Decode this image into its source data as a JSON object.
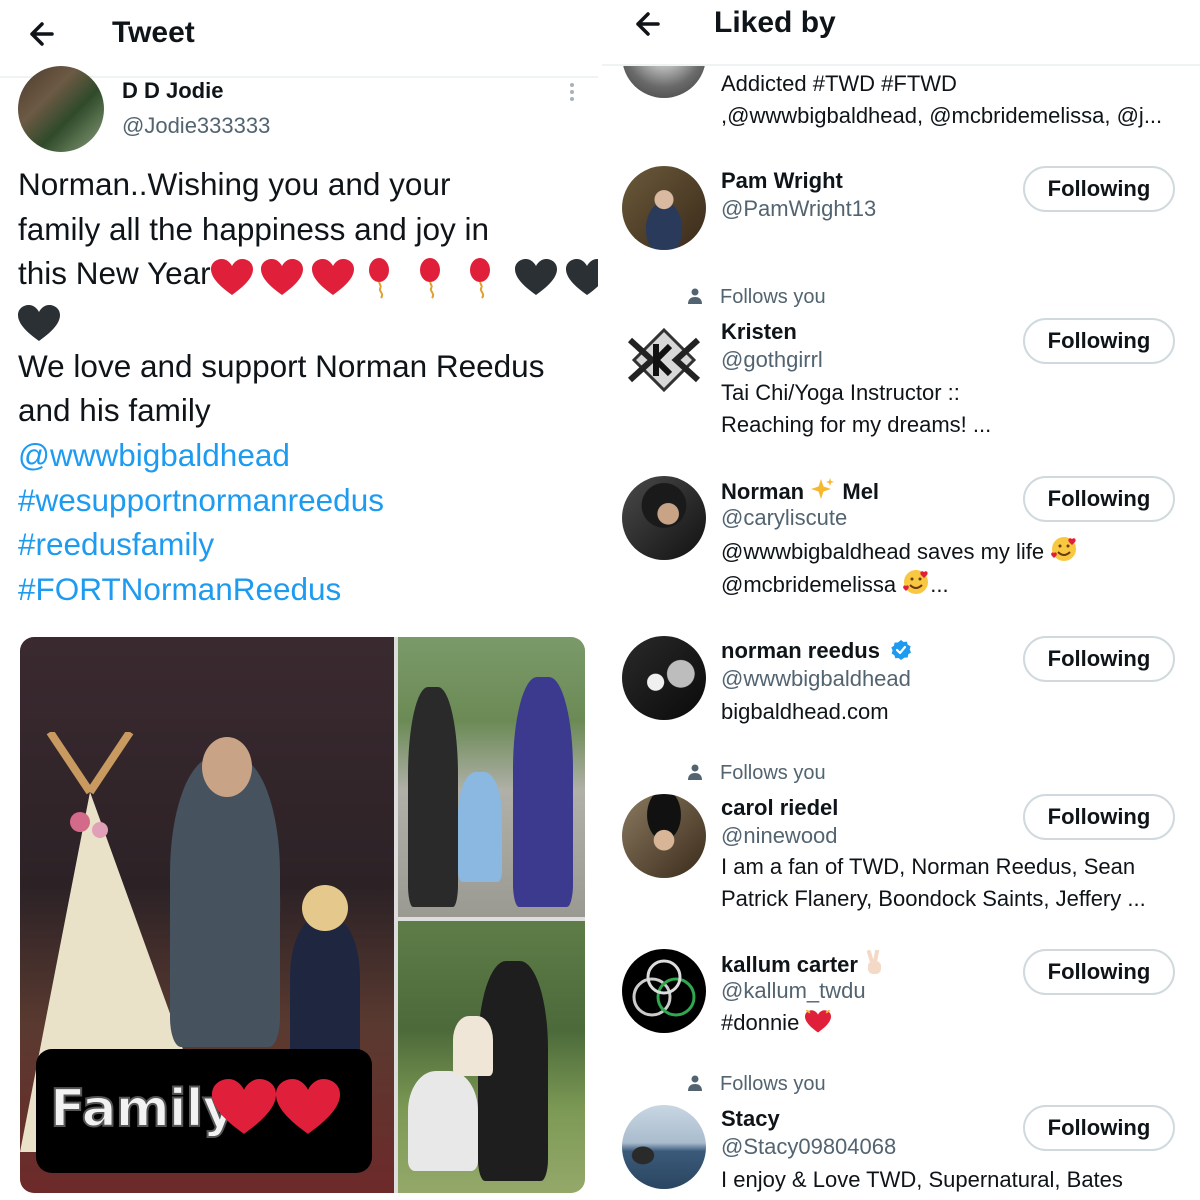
{
  "tweet_screen": {
    "title": "Tweet",
    "author": {
      "name": "D D Jodie",
      "handle": "@Jodie333333"
    },
    "text_lines": [
      "Norman..Wishing you and your",
      "family all the happiness and joy in",
      "this New Year",
      "We love and support Norman Reedus",
      "and his family"
    ],
    "links": [
      "@wwwbigbaldhead",
      "#wesupportnormanreedus",
      "#reedusfamily",
      "#FORTNormanReedus"
    ],
    "emojis": [
      "red-heart",
      "red-heart",
      "red-heart",
      "balloon",
      "balloon",
      "balloon",
      "black-heart",
      "black-heart",
      "black-heart"
    ],
    "media_caption": "Family",
    "colors": {
      "link": "#1d9bf0",
      "secondary": "#536471"
    }
  },
  "liked_by_screen": {
    "title": "Liked by",
    "follows_you_label": "Follows you",
    "top_partial_bio": [
      "Addicted #TWD #FTWD",
      ",@wwwbigbaldhead, @mcbridemelissa, @j..."
    ],
    "users": [
      {
        "name": "Pam Wright",
        "handle": "@PamWright13",
        "button": "Following",
        "bio": []
      },
      {
        "name": "Kristen",
        "handle": "@gothgirrl",
        "button": "Following",
        "follows_you": true,
        "bio": [
          "Tai Chi/Yoga Instructor ::",
          "Reaching for my dreams! ..."
        ]
      },
      {
        "name_a": "Norman",
        "name_b": "Mel",
        "handle": "@caryliscute",
        "button": "Following",
        "bio": [
          "@wwwbigbaldhead saves my life",
          "@mcbridemelissa",
          "..."
        ]
      },
      {
        "name": "norman reedus",
        "handle": "@wwwbigbaldhead",
        "button": "Following",
        "verified": true,
        "bio": [
          "bigbaldhead.com"
        ]
      },
      {
        "name": "carol riedel",
        "handle": "@ninewood",
        "button": "Following",
        "follows_you": true,
        "bio": [
          "I am a fan of TWD, Norman Reedus, Sean",
          "Patrick Flanery, Boondock Saints, Jeffery ..."
        ]
      },
      {
        "name": "kallum carter",
        "handle": "@kallum_twdu",
        "button": "Following",
        "bio": [
          "#donnie"
        ]
      },
      {
        "name": "Stacy",
        "handle": "@Stacy09804068",
        "button": "Following",
        "follows_you": true,
        "bio": [
          "I enjoy & Love TWD, Supernatural, Bates"
        ]
      }
    ]
  }
}
